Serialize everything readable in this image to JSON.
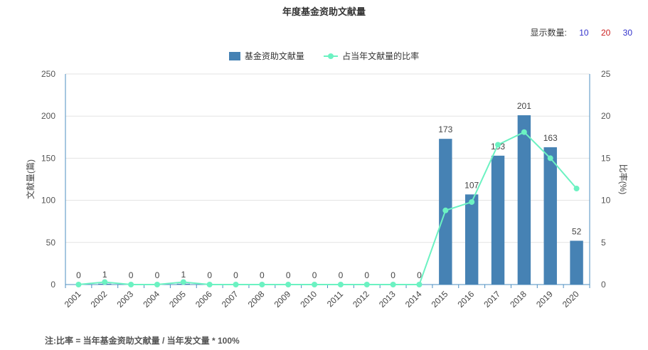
{
  "title": "年度基金资助文献量",
  "display_count": {
    "label": "显示数量:",
    "options": [
      {
        "label": "10",
        "color": "#3333cc"
      },
      {
        "label": "20",
        "color": "#cc2222"
      },
      {
        "label": "30",
        "color": "#3333cc"
      }
    ]
  },
  "legend": {
    "bar_label": "基金资助文献量",
    "line_label": "占当年文献量的比率"
  },
  "note": "注:比率 = 当年基金资助文献量 / 当年发文量 * 100%",
  "colors": {
    "bar": "#4682b4",
    "line": "#6cf2c2",
    "axis": "#4e8fc2"
  },
  "chart_data": {
    "type": "bar",
    "categories": [
      "2001",
      "2002",
      "2003",
      "2004",
      "2005",
      "2006",
      "2007",
      "2008",
      "2009",
      "2010",
      "2011",
      "2012",
      "2013",
      "2014",
      "2015",
      "2016",
      "2017",
      "2018",
      "2019",
      "2020"
    ],
    "series": [
      {
        "name": "基金资助文献量",
        "type": "bar",
        "axis": "left",
        "values": [
          0,
          1,
          0,
          0,
          1,
          0,
          0,
          0,
          0,
          0,
          0,
          0,
          0,
          0,
          173,
          107,
          153,
          201,
          163,
          52
        ]
      },
      {
        "name": "占当年文献量的比率",
        "type": "line",
        "axis": "right",
        "values": [
          0,
          0.3,
          0,
          0,
          0.3,
          0,
          0,
          0,
          0,
          0,
          0,
          0,
          0,
          0,
          8.8,
          9.8,
          16.6,
          18.1,
          15.0,
          11.4
        ]
      }
    ],
    "ylabel": "文献量(篇)",
    "y2label": "比率(%)",
    "ylim": [
      0,
      250
    ],
    "y2lim": [
      0,
      25
    ],
    "yticks": [
      0,
      50,
      100,
      150,
      200,
      250
    ],
    "y2ticks": [
      0,
      5,
      10,
      15,
      20,
      25
    ],
    "grid": true,
    "legend_position": "top"
  }
}
